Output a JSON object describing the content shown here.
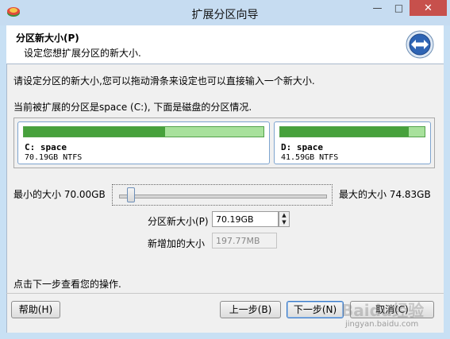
{
  "window": {
    "title": "扩展分区向导",
    "min_icon": "minimize-icon",
    "max_icon": "maximize-icon",
    "close_icon": "close-icon"
  },
  "header": {
    "title": "分区新大小(P)",
    "subtitle": "设定您想扩展分区的新大小.",
    "logo_icon": "resize-arrows-icon"
  },
  "body": {
    "instruction": "请设定分区的新大小,您可以拖动滑条来设定也可以直接输入一个新大小.",
    "current_partition_text": "当前被扩展的分区是space (C:), 下面是磁盘的分区情况."
  },
  "partitions": [
    {
      "name": "C: space",
      "info": "70.19GB NTFS",
      "used_fraction": 0.59
    },
    {
      "name": "D: space",
      "info": "41.59GB NTFS",
      "used_fraction": 0.89
    }
  ],
  "slider": {
    "min_label": "最小的大小 70.00GB",
    "max_label": "最大的大小 74.83GB",
    "position_fraction": 0.04
  },
  "fields": {
    "new_size_label": "分区新大小(P)",
    "new_size_value": "70.19GB",
    "added_size_label": "新增加的大小",
    "added_size_value": "197.77MB"
  },
  "footer": {
    "hint": "点击下一步查看您的操作.",
    "help_label": "帮助(H)",
    "back_label": "上一步(B)",
    "next_label": "下一步(N)",
    "cancel_label": "取消(C)"
  },
  "colors": {
    "title_bar": "#c6dcf1",
    "close_button": "#c7504c",
    "used_bar": "#47a13c",
    "free_bar": "#a8e19c"
  },
  "watermark": {
    "brand": "Baidu经验",
    "url": "jingyan.baidu.com"
  }
}
